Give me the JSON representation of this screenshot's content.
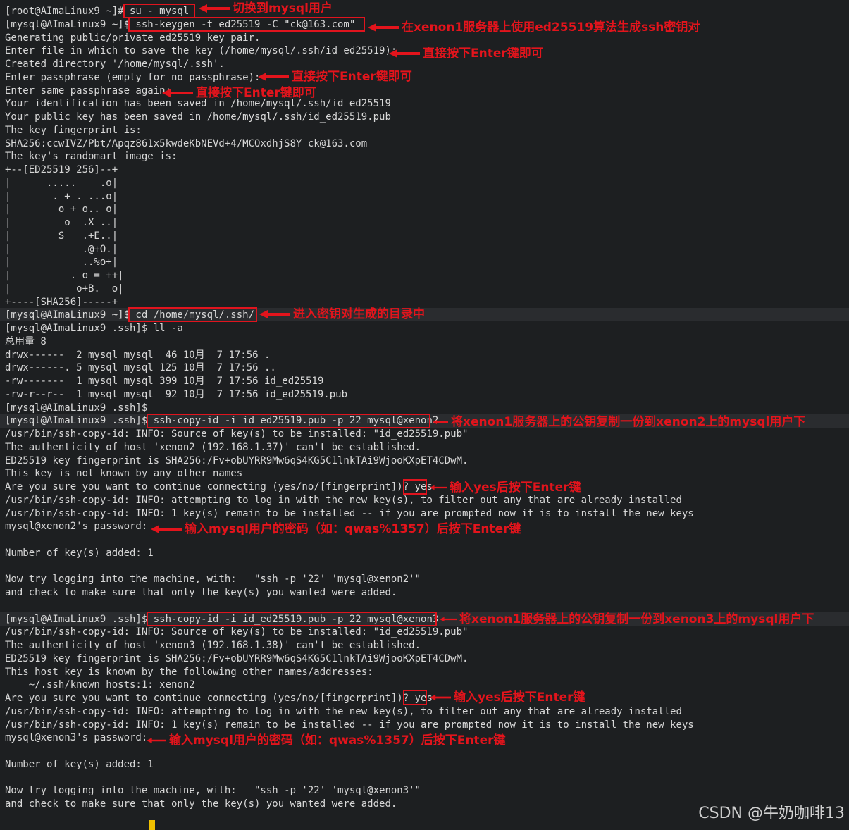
{
  "terminal": {
    "lines": [
      "[root@AImaLinux9 ~]# su - mysql",
      "[mysql@AImaLinux9 ~]$ ssh-keygen -t ed25519 -C \"ck@163.com\"",
      "Generating public/private ed25519 key pair.",
      "Enter file in which to save the key (/home/mysql/.ssh/id_ed25519):",
      "Created directory '/home/mysql/.ssh'.",
      "Enter passphrase (empty for no passphrase):",
      "Enter same passphrase again:",
      "Your identification has been saved in /home/mysql/.ssh/id_ed25519",
      "Your public key has been saved in /home/mysql/.ssh/id_ed25519.pub",
      "The key fingerprint is:",
      "SHA256:ccwIVZ/Pbt/Apqz861x5kwdeKbNEVd+4/MCOxdhjS8Y ck@163.com",
      "The key's randomart image is:",
      "+--[ED25519 256]--+",
      "|      .....    .o|",
      "|       . + . ...o|",
      "|        o + o.. o|",
      "|         o  .X ..|",
      "|        S   .+E..|",
      "|            .@+O.|",
      "|            ..%o+|",
      "|          . o = ++|",
      "|           o+B.  o|",
      "+----[SHA256]-----+",
      "[mysql@AImaLinux9 ~]$ cd /home/mysql/.ssh/",
      "[mysql@AImaLinux9 .ssh]$ ll -a",
      "总用量 8",
      "drwx------  2 mysql mysql  46 10月  7 17:56 .",
      "drwx------. 5 mysql mysql 125 10月  7 17:56 ..",
      "-rw-------  1 mysql mysql 399 10月  7 17:56 id_ed25519",
      "-rw-r--r--  1 mysql mysql  92 10月  7 17:56 id_ed25519.pub",
      "[mysql@AImaLinux9 .ssh]$",
      "[mysql@AImaLinux9 .ssh]$ ssh-copy-id -i id_ed25519.pub -p 22 mysql@xenon2",
      "/usr/bin/ssh-copy-id: INFO: Source of key(s) to be installed: \"id_ed25519.pub\"",
      "The authenticity of host 'xenon2 (192.168.1.37)' can't be established.",
      "ED25519 key fingerprint is SHA256:/Fv+obUYRR9Mw6qS4KG5C1lnkTAi9WjooKXpET4CDwM.",
      "This key is not known by any other names",
      "Are you sure you want to continue connecting (yes/no/[fingerprint])? yes",
      "/usr/bin/ssh-copy-id: INFO: attempting to log in with the new key(s), to filter out any that are already installed",
      "/usr/bin/ssh-copy-id: INFO: 1 key(s) remain to be installed -- if you are prompted now it is to install the new keys",
      "mysql@xenon2's password:",
      "",
      "Number of key(s) added: 1",
      "",
      "Now try logging into the machine, with:   \"ssh -p '22' 'mysql@xenon2'\"",
      "and check to make sure that only the key(s) you wanted were added.",
      "",
      "[mysql@AImaLinux9 .ssh]$ ssh-copy-id -i id_ed25519.pub -p 22 mysql@xenon3",
      "/usr/bin/ssh-copy-id: INFO: Source of key(s) to be installed: \"id_ed25519.pub\"",
      "The authenticity of host 'xenon3 (192.168.1.38)' can't be established.",
      "ED25519 key fingerprint is SHA256:/Fv+obUYRR9Mw6qS4KG5C1lnkTAi9WjooKXpET4CDwM.",
      "This host key is known by the following other names/addresses:",
      "    ~/.ssh/known_hosts:1: xenon2",
      "Are you sure you want to continue connecting (yes/no/[fingerprint])? yes",
      "/usr/bin/ssh-copy-id: INFO: attempting to log in with the new key(s), to filter out any that are already installed",
      "/usr/bin/ssh-copy-id: INFO: 1 key(s) remain to be installed -- if you are prompted now it is to install the new keys",
      "mysql@xenon3's password:",
      "",
      "Number of key(s) added: 1",
      "",
      "Now try logging into the machine, with:   \"ssh -p '22' 'mysql@xenon3'\"",
      "and check to make sure that only the key(s) you wanted were added."
    ]
  },
  "annotations": {
    "su_mysql": "切换到mysql用户",
    "keygen": "在xenon1服务器上使用ed25519算法生成ssh密钥对",
    "enter_file": "直接按下Enter键即可",
    "enter_passphrase": "直接按下Enter键即可",
    "enter_again": "直接按下Enter键即可",
    "cd_dir": "进入密钥对生成的目录中",
    "copy_xenon2": "将xenon1服务器上的公钥复制一份到xenon2上的mysql用户下",
    "yes_xenon2": "输入yes后按下Enter键",
    "password_xenon2": "输入mysql用户的密码（如：qwas%1357）后按下Enter键",
    "copy_xenon3": "将xenon1服务器上的公钥复制一份到xenon3上的mysql用户下",
    "yes_xenon3": "输入yes后按下Enter键",
    "password_xenon3": "输入mysql用户的密码（如：qwas%1357）后按下Enter键"
  },
  "watermark": "CSDN @牛奶咖啡13",
  "colors": {
    "background": "#1d1f21",
    "text": "#d7d7d7",
    "annotation": "#e3141c",
    "cursor": "#f0c000"
  }
}
